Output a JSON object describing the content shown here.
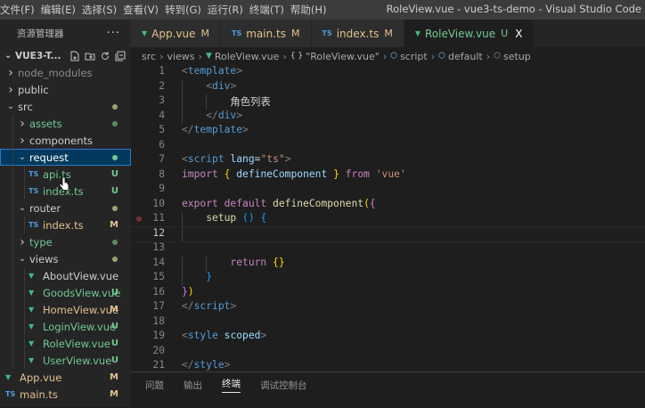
{
  "menu": [
    "文件(F)",
    "编辑(E)",
    "选择(S)",
    "查看(V)",
    "转到(G)",
    "运行(R)",
    "终端(T)",
    "帮助(H)"
  ],
  "window_title": "RoleView.vue - vue3-ts-demo - Visual Studio Code",
  "sidebar": {
    "title": "资源管理器",
    "more": "···",
    "project": "VUE3-T...",
    "tree": [
      {
        "label": "node_modules",
        "kind": "folder",
        "expanded": false,
        "color": "#8c8c8c"
      },
      {
        "label": "public",
        "kind": "folder",
        "expanded": false,
        "color": "#cccccc"
      },
      {
        "label": "src",
        "kind": "folder",
        "expanded": true,
        "color": "#cccccc",
        "dot": "#a0a070"
      },
      {
        "label": "assets",
        "kind": "folder",
        "expanded": false,
        "color": "#73c991",
        "dot": "#5e8a5e"
      },
      {
        "label": "components",
        "kind": "folder",
        "expanded": false,
        "color": "#cccccc"
      },
      {
        "label": "request",
        "kind": "folder",
        "expanded": true,
        "color": "#ffffff",
        "selected": true,
        "dot": "#73c991"
      },
      {
        "label": "api.ts",
        "kind": "ts",
        "color": "#73c991",
        "status": "U"
      },
      {
        "label": "index.ts",
        "kind": "ts",
        "color": "#73c991",
        "status": "U"
      },
      {
        "label": "router",
        "kind": "folder",
        "expanded": true,
        "color": "#cccccc",
        "dot": "#a0a070"
      },
      {
        "label": "index.ts",
        "kind": "ts",
        "color": "#e2c08d",
        "status": "M"
      },
      {
        "label": "type",
        "kind": "folder",
        "expanded": false,
        "color": "#73c991",
        "dot": "#5e8a5e"
      },
      {
        "label": "views",
        "kind": "folder",
        "expanded": true,
        "color": "#cccccc",
        "dot": "#a0a070"
      },
      {
        "label": "AboutView.vue",
        "kind": "vue",
        "color": "#cccccc"
      },
      {
        "label": "GoodsView.vue",
        "kind": "vue",
        "color": "#73c991",
        "status": "U"
      },
      {
        "label": "HomeView.vue",
        "kind": "vue",
        "color": "#e2c08d",
        "status": "M"
      },
      {
        "label": "LoginView.vue",
        "kind": "vue",
        "color": "#73c991",
        "status": "U"
      },
      {
        "label": "RoleView.vue",
        "kind": "vue",
        "color": "#73c991",
        "status": "U"
      },
      {
        "label": "UserView.vue",
        "kind": "vue",
        "color": "#73c991",
        "status": "U"
      },
      {
        "label": "App.vue",
        "kind": "vue",
        "color": "#e2c08d",
        "status": "M"
      },
      {
        "label": "main.ts",
        "kind": "ts",
        "color": "#e2c08d",
        "status": "M"
      }
    ]
  },
  "tabs": [
    {
      "label": "App.vue",
      "kind": "vue",
      "status": "M",
      "active": false
    },
    {
      "label": "main.ts",
      "kind": "ts",
      "status": "M",
      "active": false
    },
    {
      "label": "index.ts",
      "kind": "ts",
      "status": "M",
      "active": false
    },
    {
      "label": "RoleView.vue",
      "kind": "vue",
      "status": "U",
      "active": true,
      "close": "X"
    }
  ],
  "breadcrumb": [
    "src",
    "views",
    "RoleView.vue",
    "\"RoleView.vue\"",
    "script",
    "default",
    "setup"
  ],
  "code": [
    {
      "n": "1",
      "tokens": [
        [
          "tag-punct",
          "<"
        ],
        [
          "tag",
          "template"
        ],
        [
          "tag-punct",
          ">"
        ]
      ]
    },
    {
      "n": "2",
      "indent": 1,
      "tokens": [
        [
          "tag-punct",
          "<"
        ],
        [
          "tag",
          "div"
        ],
        [
          "tag-punct",
          ">"
        ]
      ]
    },
    {
      "n": "3",
      "indent": 2,
      "tokens": [
        [
          "text",
          "角色列表"
        ]
      ]
    },
    {
      "n": "4",
      "indent": 1,
      "tokens": [
        [
          "tag-punct",
          "</"
        ],
        [
          "tag",
          "div"
        ],
        [
          "tag-punct",
          ">"
        ]
      ]
    },
    {
      "n": "5",
      "tokens": [
        [
          "tag-punct",
          "</"
        ],
        [
          "tag",
          "template"
        ],
        [
          "tag-punct",
          ">"
        ]
      ]
    },
    {
      "n": "6",
      "tokens": []
    },
    {
      "n": "7",
      "tokens": [
        [
          "tag-punct",
          "<"
        ],
        [
          "tag",
          "script"
        ],
        [
          "text",
          " "
        ],
        [
          "attr",
          "lang"
        ],
        [
          "text",
          "="
        ],
        [
          "str",
          "\"ts\""
        ],
        [
          "tag-punct",
          ">"
        ]
      ]
    },
    {
      "n": "8",
      "tokens": [
        [
          "kw",
          "import"
        ],
        [
          "text",
          " "
        ],
        [
          "br1",
          "{"
        ],
        [
          "text",
          " "
        ],
        [
          "attr",
          "defineComponent"
        ],
        [
          "text",
          " "
        ],
        [
          "br1",
          "}"
        ],
        [
          "text",
          " "
        ],
        [
          "kw",
          "from"
        ],
        [
          "text",
          " "
        ],
        [
          "str",
          "'vue'"
        ]
      ]
    },
    {
      "n": "9",
      "tokens": []
    },
    {
      "n": "10",
      "tokens": [
        [
          "kw",
          "export"
        ],
        [
          "text",
          " "
        ],
        [
          "kw",
          "default"
        ],
        [
          "text",
          " "
        ],
        [
          "fn",
          "defineComponent"
        ],
        [
          "br1",
          "("
        ],
        [
          "br2",
          "{"
        ]
      ]
    },
    {
      "n": "11",
      "indent": 1,
      "tokens": [
        [
          "fn",
          "setup"
        ],
        [
          "text",
          " "
        ],
        [
          "br3",
          "()"
        ],
        [
          "text",
          " "
        ],
        [
          "br3",
          "{"
        ]
      ],
      "breakpoint": true
    },
    {
      "n": "12",
      "indent": 1,
      "tokens": [],
      "current": true
    },
    {
      "n": "13",
      "tokens": []
    },
    {
      "n": "14",
      "indent": 2,
      "tokens": [
        [
          "kw",
          "return"
        ],
        [
          "text",
          " "
        ],
        [
          "br1",
          "{}"
        ]
      ]
    },
    {
      "n": "15",
      "indent": 1,
      "tokens": [
        [
          "br3",
          "}"
        ]
      ]
    },
    {
      "n": "16",
      "tokens": [
        [
          "br2",
          "}"
        ],
        [
          "br1",
          ")"
        ]
      ]
    },
    {
      "n": "17",
      "tokens": [
        [
          "tag-punct",
          "</"
        ],
        [
          "tag",
          "script"
        ],
        [
          "tag-punct",
          ">"
        ]
      ]
    },
    {
      "n": "18",
      "tokens": []
    },
    {
      "n": "19",
      "tokens": [
        [
          "tag-punct",
          "<"
        ],
        [
          "tag",
          "style"
        ],
        [
          "text",
          " "
        ],
        [
          "attr",
          "scoped"
        ],
        [
          "tag-punct",
          ">"
        ]
      ]
    },
    {
      "n": "20",
      "tokens": []
    },
    {
      "n": "21",
      "tokens": [
        [
          "tag-punct",
          "</"
        ],
        [
          "tag",
          "style"
        ],
        [
          "tag-punct",
          ">"
        ]
      ]
    }
  ],
  "panel_tabs": [
    {
      "label": "问题",
      "active": false
    },
    {
      "label": "输出",
      "active": false
    },
    {
      "label": "终端",
      "active": true
    },
    {
      "label": "调试控制台",
      "active": false
    }
  ]
}
